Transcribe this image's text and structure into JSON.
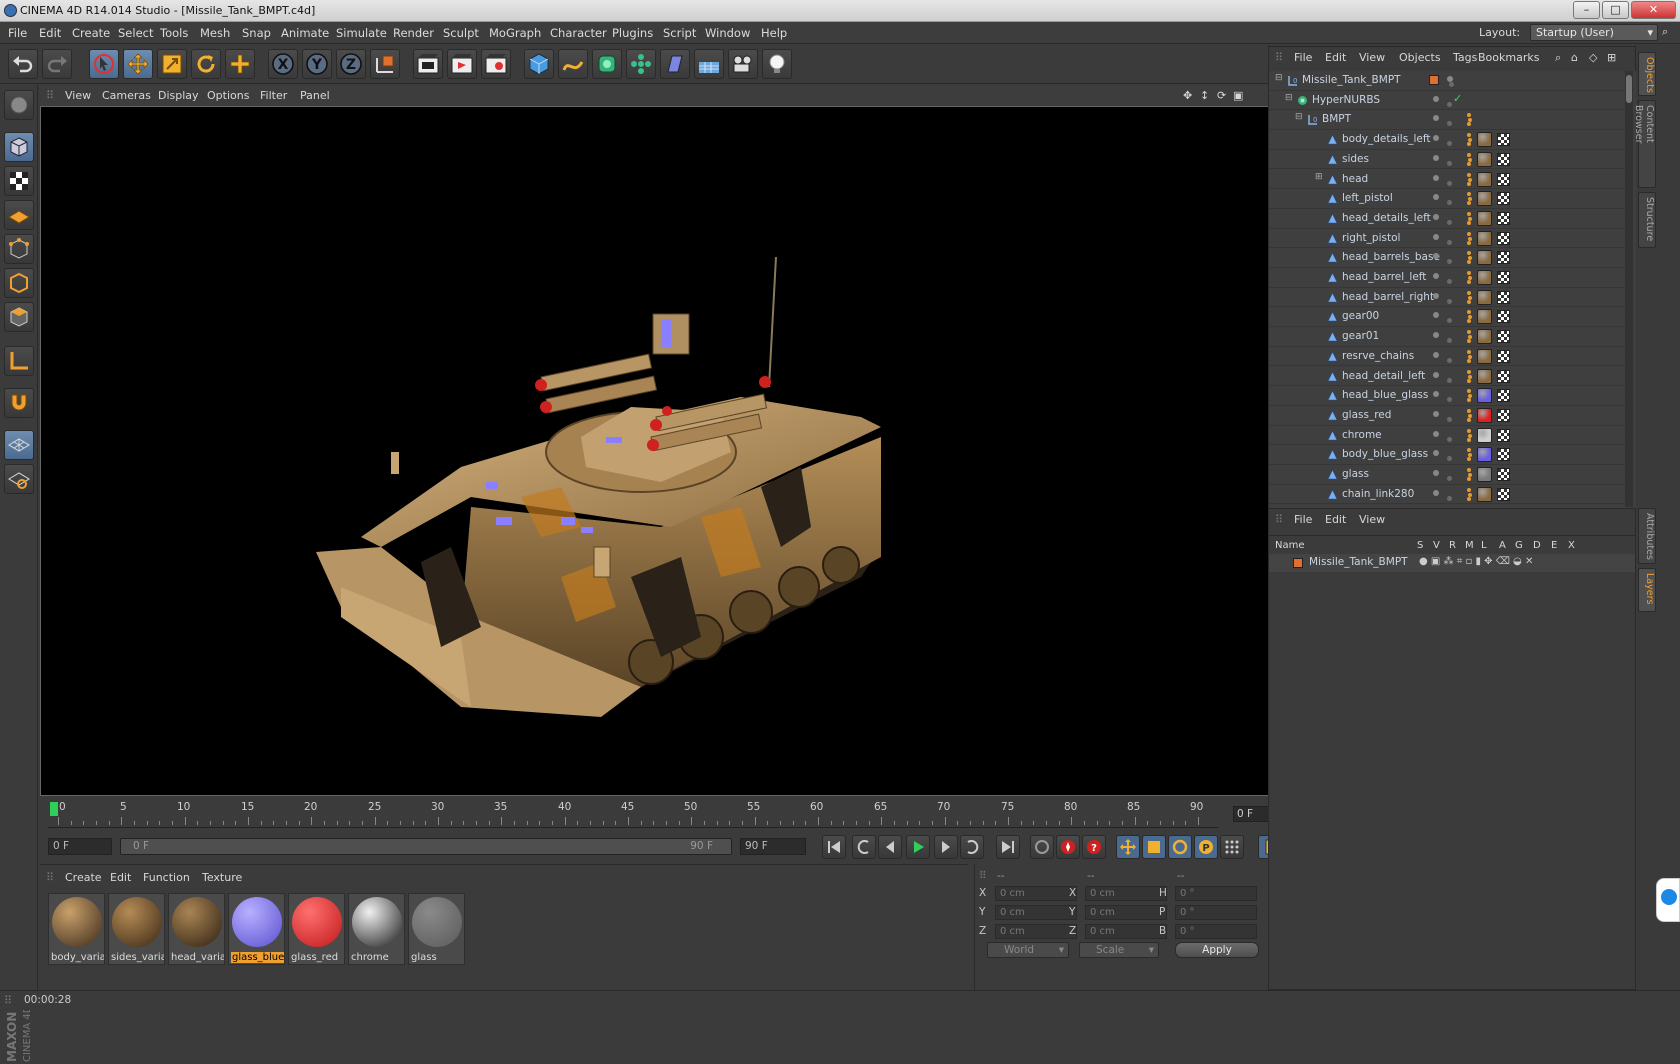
{
  "window": {
    "title": "CINEMA 4D R14.014 Studio - [Missile_Tank_BMPT.c4d]"
  },
  "menubar": {
    "items": [
      "File",
      "Edit",
      "Create",
      "Select",
      "Tools",
      "Mesh",
      "Snap",
      "Animate",
      "Simulate",
      "Render",
      "Sculpt",
      "MoGraph",
      "Character",
      "Plugins",
      "Script",
      "Window",
      "Help"
    ],
    "layout_label": "Layout:",
    "layout_value": "Startup (User)"
  },
  "toolbar": {
    "icons": [
      "undo-icon",
      "redo-icon",
      "live-selection-icon",
      "move-icon",
      "scale-icon",
      "rotate-icon",
      "add-object-icon",
      "x-axis-icon",
      "y-axis-icon",
      "z-axis-icon",
      "coordinate-system-icon",
      "render-view-icon",
      "render-picture-viewer-icon",
      "edit-render-settings-icon",
      "cube-icon",
      "spline-pen-icon",
      "nurbs-icon",
      "array-icon",
      "deformer-icon",
      "floor-environment-icon",
      "camera-icon",
      "light-icon"
    ]
  },
  "viewport": {
    "menu": [
      "View",
      "Cameras",
      "Display",
      "Options",
      "Filter",
      "Panel"
    ]
  },
  "timeline": {
    "labels": [
      "0",
      "5",
      "10",
      "15",
      "20",
      "25",
      "30",
      "35",
      "40",
      "45",
      "50",
      "55",
      "60",
      "65",
      "70",
      "75",
      "80",
      "85",
      "90"
    ],
    "current_frame": "0 F",
    "start_field": "0 F",
    "slider_start": "0 F",
    "slider_end": "90 F",
    "end_field": "90 F"
  },
  "materials": {
    "menu": [
      "Create",
      "Edit",
      "Function",
      "Texture"
    ],
    "items": [
      {
        "label": "body_varia",
        "color1": "#c9a06a",
        "color2": "#3b2a1a",
        "selected": false
      },
      {
        "label": "sides_varia",
        "color1": "#b58b55",
        "color2": "#3a2815",
        "selected": false
      },
      {
        "label": "head_varia",
        "color1": "#a98555",
        "color2": "#2e2010",
        "selected": false
      },
      {
        "label": "glass_blue",
        "color1": "#b8b0ff",
        "color2": "#5a4fd0",
        "selected": true
      },
      {
        "label": "glass_red",
        "color1": "#ff7070",
        "color2": "#c01818",
        "selected": false
      },
      {
        "label": "chrome",
        "color1": "#f0f0f0",
        "color2": "#1a1a1a",
        "selected": false
      },
      {
        "label": "glass",
        "color1": "#8a8a8a",
        "color2": "#5a5a5a",
        "selected": false
      }
    ]
  },
  "coordinates": {
    "headers": [
      "--",
      "--",
      "--"
    ],
    "rows": [
      {
        "a": "X",
        "av": "0 cm",
        "b": "X",
        "bv": "0 cm",
        "c": "H",
        "cv": "0 °"
      },
      {
        "a": "Y",
        "av": "0 cm",
        "b": "Y",
        "bv": "0 cm",
        "c": "P",
        "cv": "0 °"
      },
      {
        "a": "Z",
        "av": "0 cm",
        "b": "Z",
        "bv": "0 cm",
        "c": "B",
        "cv": "0 °"
      }
    ],
    "mode1": "World",
    "mode2": "Scale",
    "apply": "Apply"
  },
  "objects": {
    "menu": [
      "File",
      "Edit",
      "View",
      "Objects",
      "Tags",
      "Bookmarks"
    ],
    "rows": [
      {
        "name": "Missile_Tank_BMPT",
        "level": 0,
        "type": "null",
        "tags": "none"
      },
      {
        "name": "HyperNURBS",
        "level": 1,
        "type": "nurbs",
        "tags": "check"
      },
      {
        "name": "BMPT",
        "level": 2,
        "type": "null",
        "tags": "texonly"
      },
      {
        "name": "body_details_left",
        "level": 3,
        "type": "poly",
        "mat": "#8a6a40"
      },
      {
        "name": "sides",
        "level": 3,
        "type": "poly",
        "mat": "#8a6a40"
      },
      {
        "name": "head",
        "level": 3,
        "type": "poly",
        "mat": "#8a6a40",
        "expand": true
      },
      {
        "name": "left_pistol",
        "level": 3,
        "type": "poly",
        "mat": "#8a6a40"
      },
      {
        "name": "head_details_left",
        "level": 3,
        "type": "poly",
        "mat": "#8a6a40"
      },
      {
        "name": "right_pistol",
        "level": 3,
        "type": "poly",
        "mat": "#8a6a40"
      },
      {
        "name": "head_barrels_base",
        "level": 3,
        "type": "poly",
        "mat": "#8a6a40"
      },
      {
        "name": "head_barrel_left",
        "level": 3,
        "type": "poly",
        "mat": "#8a6a40"
      },
      {
        "name": "head_barrel_right",
        "level": 3,
        "type": "poly",
        "mat": "#8a6a40"
      },
      {
        "name": "gear00",
        "level": 3,
        "type": "poly",
        "mat": "#8a6a40"
      },
      {
        "name": "gear01",
        "level": 3,
        "type": "poly",
        "mat": "#8a6a40"
      },
      {
        "name": "resrve_chains",
        "level": 3,
        "type": "poly",
        "mat": "#8a6a40"
      },
      {
        "name": "head_detail_left",
        "level": 3,
        "type": "poly",
        "mat": "#8a6a40"
      },
      {
        "name": "head_blue_glass",
        "level": 3,
        "type": "poly",
        "mat": "#6a5fe0"
      },
      {
        "name": "glass_red",
        "level": 3,
        "type": "poly",
        "mat": "#e02020"
      },
      {
        "name": "chrome",
        "level": 3,
        "type": "poly",
        "mat": "#d0d0d0"
      },
      {
        "name": "body_blue_glass",
        "level": 3,
        "type": "poly",
        "mat": "#6a5fe0"
      },
      {
        "name": "glass",
        "level": 3,
        "type": "poly",
        "mat": "#7a7a7a"
      },
      {
        "name": "chain_link280",
        "level": 3,
        "type": "poly",
        "mat": "#8a6a40"
      }
    ]
  },
  "layers": {
    "menu": [
      "File",
      "Edit",
      "View"
    ],
    "headers": [
      "Name",
      "S",
      "V",
      "R",
      "M",
      "L",
      "A",
      "G",
      "D",
      "E",
      "X"
    ],
    "row": "Missile_Tank_BMPT"
  },
  "siderail": {
    "tabs": [
      "Objects",
      "Content Browser",
      "Structure",
      "Attributes",
      "Layers"
    ]
  },
  "status": {
    "time": "00:00:28"
  },
  "branding": {
    "logo": "MAXON CINEMA 4D"
  },
  "colors": {
    "accent": "#f0a030",
    "selection": "#4a6a90",
    "bg": "#3b3b3b"
  }
}
